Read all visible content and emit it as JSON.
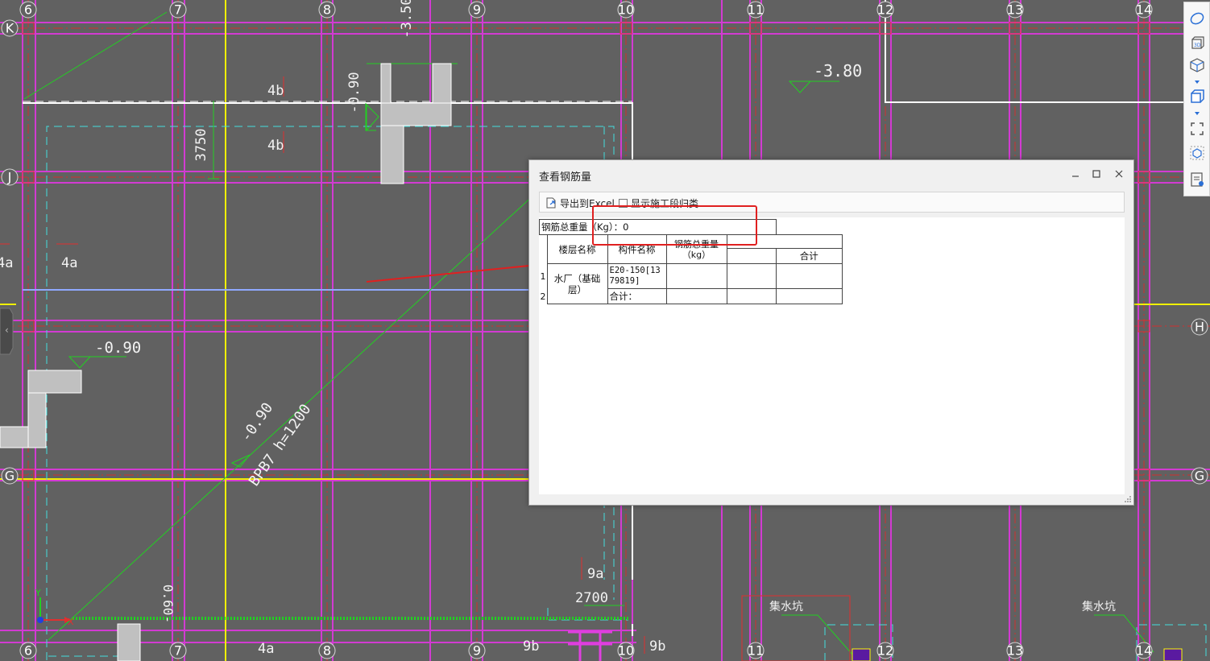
{
  "canvas": {
    "grid_columns": [
      "6",
      "7",
      "8",
      "9",
      "10",
      "11",
      "12",
      "13",
      "14"
    ],
    "grid_rows": [
      "K",
      "J",
      "H",
      "G"
    ],
    "elevation_labels": [
      "-3.50",
      "-0.90",
      "-3.80",
      "-0.90",
      "-0.90"
    ],
    "dimension_labels": [
      "3750",
      "2700",
      "0.60-"
    ],
    "rebar_labels": [
      "4b",
      "4b",
      "4a",
      "4a",
      "4a",
      "9a",
      "9b",
      "9b"
    ],
    "beam_label": "BPB7 h=1200",
    "well_labels": [
      "集水坑",
      "集水坑"
    ],
    "axis_indicator": {
      "y": "Y",
      "x": "X"
    }
  },
  "toolbar": {
    "items": [
      {
        "icon": "orbit-icon"
      },
      {
        "icon": "3d-view-icon"
      },
      {
        "icon": "cube-view-icon"
      },
      {
        "icon": "box-icon"
      },
      {
        "icon": "fullscreen-icon"
      },
      {
        "icon": "cube-select-icon"
      },
      {
        "icon": "report-icon"
      }
    ]
  },
  "dialog": {
    "title": "查看钢筋量",
    "export_label": "导出到Excel",
    "show_category_label": "显示施工段归类",
    "table": {
      "total_weight_label": "钢筋总重量（Kg）：0",
      "col_floor": "楼层名称",
      "col_component": "构件名称",
      "col_weight": "钢筋总重量（kg）",
      "col_total": "合计",
      "rows": [
        {
          "index": "1",
          "floor": "水厂（基础层）",
          "component": "E20-150[1379819]"
        },
        {
          "index": "2",
          "floor": "",
          "component": "合计："
        }
      ]
    }
  }
}
